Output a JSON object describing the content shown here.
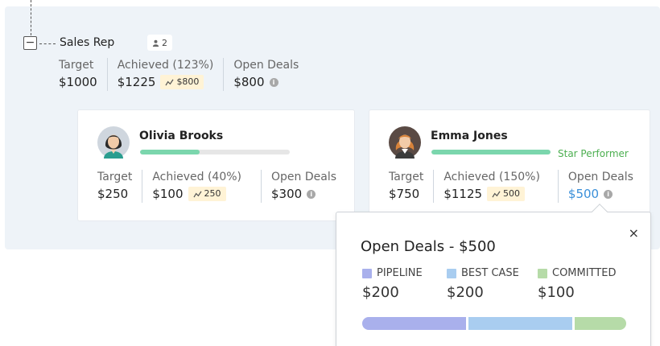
{
  "rep": {
    "title": "Sales Rep",
    "member_count": "2",
    "collapse_symbol": "−",
    "stats": {
      "target_label": "Target",
      "target_value": "$1000",
      "achieved_label": "Achieved (123%)",
      "achieved_value": "$1225",
      "achieved_trend": "$800",
      "open_label": "Open Deals",
      "open_value": "$800"
    }
  },
  "members": [
    {
      "name": "Olivia Brooks",
      "progress": 0.4,
      "badge": "",
      "target_label": "Target",
      "target_value": "$250",
      "achieved_label": "Achieved (40%)",
      "achieved_value": "$100",
      "achieved_trend": "250",
      "open_label": "Open Deals",
      "open_value": "$300"
    },
    {
      "name": "Emma Jones",
      "progress": 1.0,
      "badge": "Star Performer",
      "target_label": "Target",
      "target_value": "$750",
      "achieved_label": "Achieved (150%)",
      "achieved_value": "$1125",
      "achieved_trend": "500",
      "open_label": "Open Deals",
      "open_value": "$500"
    }
  ],
  "popover": {
    "title": "Open Deals - $500",
    "close": "×",
    "segments": [
      {
        "label": "PIPELINE",
        "value": "$200",
        "amount": 200,
        "color": "#a9b0ec"
      },
      {
        "label": "BEST CASE",
        "value": "$200",
        "amount": 200,
        "color": "#a9cdf0"
      },
      {
        "label": "COMMITTED",
        "value": "$100",
        "amount": 100,
        "color": "#b6dba8"
      }
    ]
  },
  "colors": {
    "panel_bg": "#eef3f8",
    "progress_fill": "#7bd6ad",
    "trend_bg": "#fff3d6",
    "link": "#3a8fd9",
    "star_performer": "#4caf50"
  }
}
